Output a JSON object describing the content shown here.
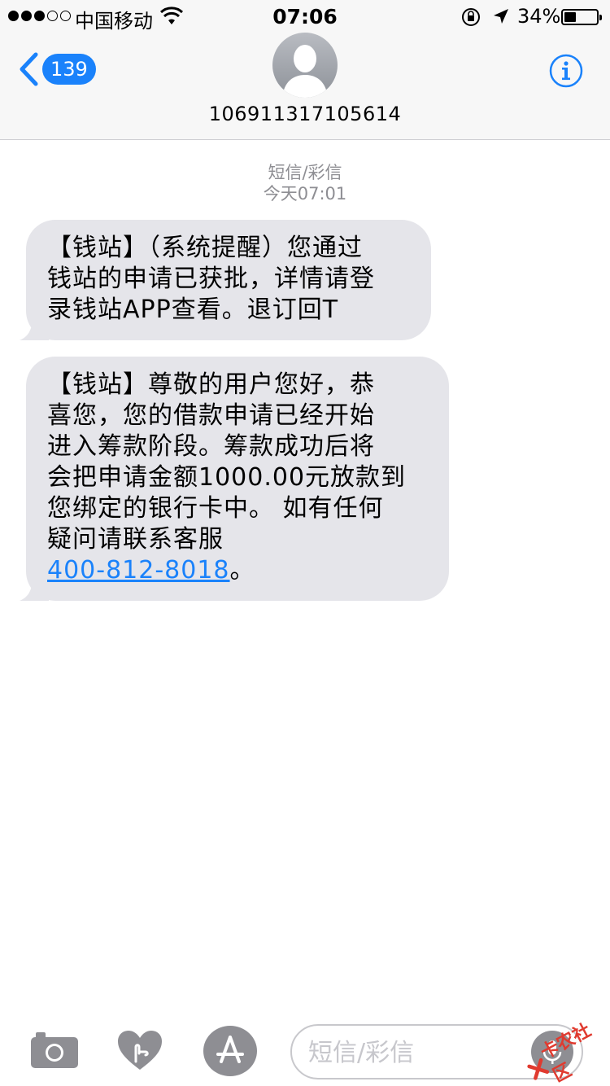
{
  "status_bar": {
    "carrier": "中国移动",
    "time": "07:06",
    "battery_percent": "34%",
    "battery_level": 0.34,
    "signal_bars_filled": 3,
    "signal_bars_total": 5
  },
  "header": {
    "back_badge": "139",
    "contact_name": "106911317105614"
  },
  "conversation": {
    "service_label": "短信/彩信",
    "timestamp": "今天07:01",
    "messages": [
      {
        "lines": [
          "【钱站】（系统提醒）您通过",
          "钱站的申请已获批，详情请登",
          "录钱站APP查看。退订回T"
        ]
      },
      {
        "lines": [
          "【钱站】尊敬的用户您好，恭",
          "喜您，您的借款申请已经开始",
          "进入筹款阶段。筹款成功后将",
          "会把申请金额1000.00元放款到",
          "您绑定的银行卡中。 如有任何",
          "疑问请联系客服"
        ],
        "link_text": "400-812-8018",
        "link_suffix": "。"
      }
    ]
  },
  "composer": {
    "placeholder": "短信/彩信"
  },
  "watermark": {
    "text": "卡农社区"
  },
  "colors": {
    "accent": "#1a82fb",
    "bubble": "#e5e5ea",
    "meta_text": "#8e8e93",
    "nav_bg": "#f7f7f7"
  },
  "icons": {
    "back": "chevron-left-icon",
    "info": "info-icon",
    "camera": "camera-icon",
    "heart": "digital-touch-icon",
    "appstore": "app-store-icon",
    "mic": "mic-icon"
  }
}
